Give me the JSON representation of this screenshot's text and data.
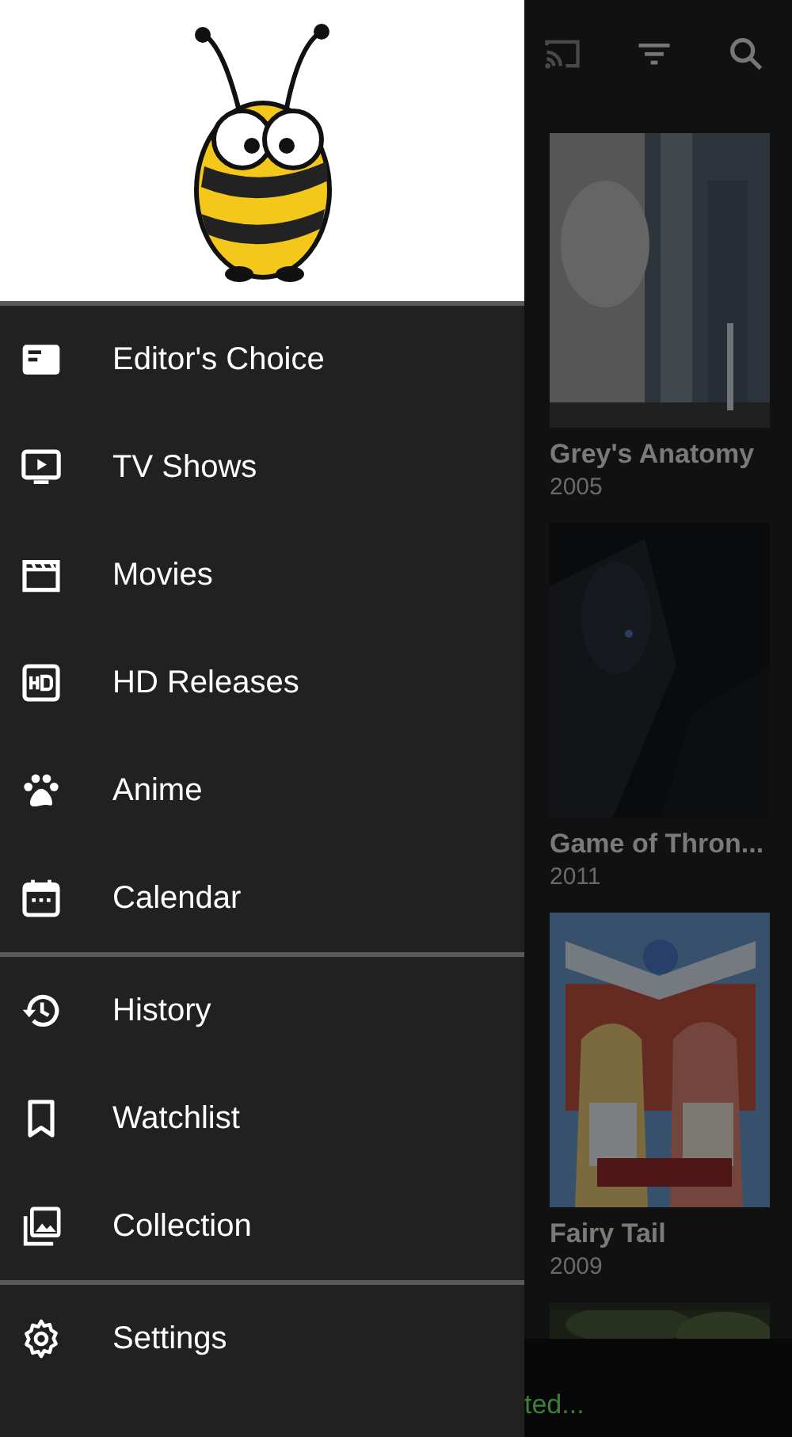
{
  "drawer": {
    "sections": [
      [
        {
          "label": "Editor's Choice"
        },
        {
          "label": "TV Shows"
        },
        {
          "label": "Movies"
        },
        {
          "label": "HD Releases"
        },
        {
          "label": "Anime"
        },
        {
          "label": "Calendar"
        }
      ],
      [
        {
          "label": "History"
        },
        {
          "label": "Watchlist"
        },
        {
          "label": "Collection"
        }
      ],
      [
        {
          "label": "Settings"
        }
      ]
    ]
  },
  "shows": [
    {
      "title": "Grey's Anatomy",
      "year": "2005"
    },
    {
      "title": "Game of Thron...",
      "year": "2011"
    },
    {
      "title": "Fairy Tail",
      "year": "2009"
    }
  ],
  "snackbar": {
    "text": "ted..."
  }
}
